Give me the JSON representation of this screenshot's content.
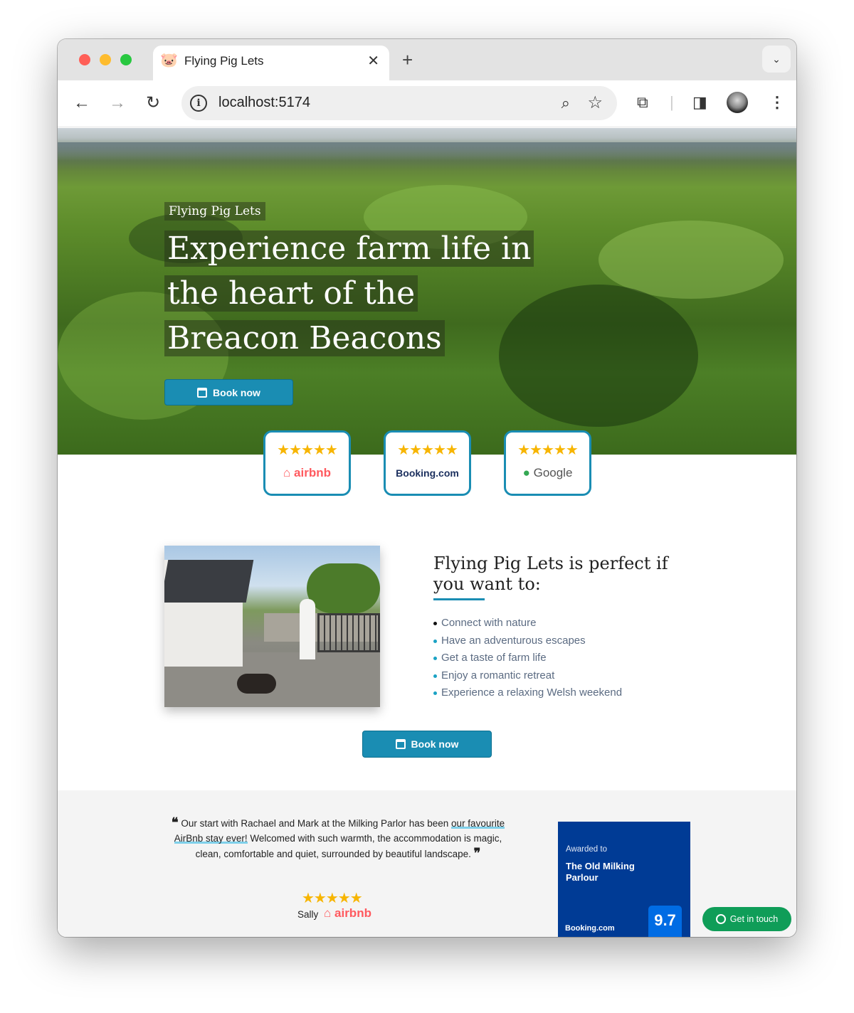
{
  "browser": {
    "tab_title": "Flying Pig Lets",
    "tab_favicon": "🐷",
    "url": "localhost:5174"
  },
  "hero": {
    "brand": "Flying Pig Lets",
    "headline": "Experience farm life in the heart of the Breacon Beacons",
    "cta": "Book now"
  },
  "reviews": [
    {
      "platform": "airbnb",
      "stars": "★★★★★"
    },
    {
      "platform": "Booking.com",
      "stars": "★★★★★"
    },
    {
      "platform": "Google",
      "stars": "★★★★★"
    }
  ],
  "perfect": {
    "title": "Flying Pig Lets is perfect if you want to:",
    "items": [
      "Connect with nature",
      "Have an adventurous escapes",
      "Get a taste of farm life",
      "Enjoy a romantic retreat",
      "Experience a relaxing Welsh weekend"
    ],
    "cta": "Book now"
  },
  "testimonial": {
    "open_quote": "❝",
    "text_before": "Our start with Rachael and Mark at the Milking Parlor has been ",
    "highlight": "our favourite AirBnb stay ever!",
    "text_after": " Welcomed with such warmth, the accommodation is magic, clean, comfortable and quiet, surrounded by beautiful landscape.",
    "close_quote": "❞",
    "stars": "★★★★★",
    "author": "Sally",
    "platform": "airbnb"
  },
  "award": {
    "label": "Awarded to",
    "name": "The Old Milking Parlour",
    "brand": "Booking.com",
    "score": "9.7"
  },
  "contact": {
    "label": "Get in touch"
  },
  "colors": {
    "accent": "#1a8db3",
    "star": "#f7b500",
    "airbnb": "#ff5a5f",
    "booking": "#003b95",
    "whatsapp": "#0f9d58"
  }
}
